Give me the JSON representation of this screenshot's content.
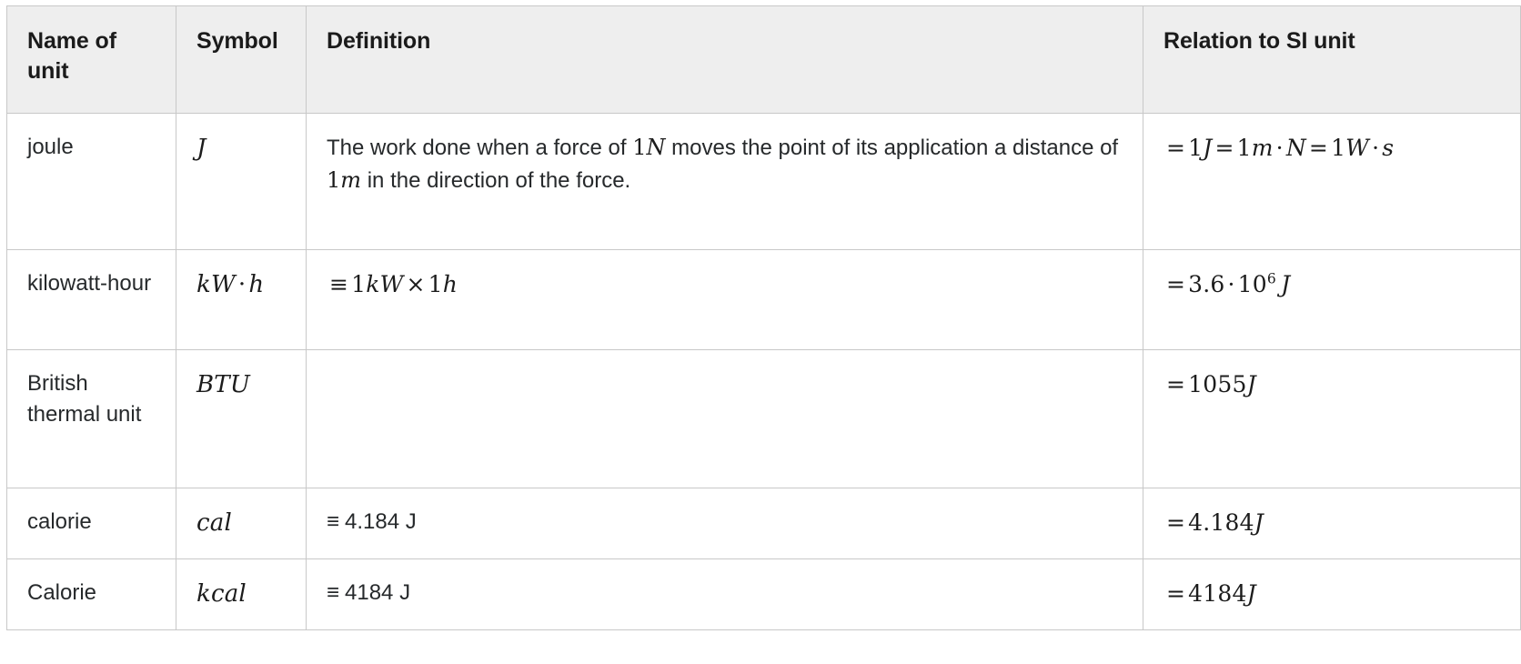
{
  "table": {
    "headers": [
      {
        "key": "name",
        "label": "Name of unit"
      },
      {
        "key": "symbol",
        "label": "Symbol"
      },
      {
        "key": "definition",
        "label": "Definition"
      },
      {
        "key": "relation",
        "label": "Relation to SI unit"
      }
    ],
    "rows": [
      {
        "name": "joule",
        "symbol": "J",
        "definition_parts": {
          "t1": "The work done when a force of ",
          "m1_num": "1",
          "m1_unit": "N",
          "t2": " moves the point of its application a distance of ",
          "m2_num": "1",
          "m2_unit": "m",
          "t3": " in the direction of the force."
        },
        "relation": {
          "eq1": "=",
          "n1": "1",
          "u1": "J",
          "eq2": "=",
          "n2": "1",
          "u2": "m",
          "dot1": "·",
          "u3": "N",
          "eq3": "=",
          "n3": "1",
          "u4": "W",
          "dot2": "·",
          "u5": "s"
        }
      },
      {
        "name": "kilowatt-hour",
        "symbol_parts": {
          "u1": "kW",
          "dot": "·",
          "u2": "h"
        },
        "definition": {
          "equiv": "≡",
          "n1": "1",
          "u1": "kW",
          "times": "×",
          "n2": "1",
          "u2": "h"
        },
        "relation": {
          "eq": "=",
          "mantissa": "3.6",
          "dot": "·",
          "base": "10",
          "exp": "6",
          "unit": "J"
        }
      },
      {
        "name": "British thermal unit",
        "symbol": "BTU",
        "definition": "",
        "relation": {
          "eq": "=",
          "value": "1055",
          "unit": "J"
        }
      },
      {
        "name": "calorie",
        "symbol": "cal",
        "definition_plain": {
          "equiv": "≡",
          "text": "4.184 J"
        },
        "relation": {
          "eq": "=",
          "value": "4.184",
          "unit": "J"
        }
      },
      {
        "name": "Calorie",
        "symbol": "kcal",
        "definition_plain": {
          "equiv": "≡",
          "text": "4184 J"
        },
        "relation": {
          "eq": "=",
          "value": "4184",
          "unit": "J"
        }
      }
    ]
  },
  "colors": {
    "header_background": "#eeeeee",
    "border": "#c8c8c8",
    "text": "#26292b",
    "header_text": "#1b1b1b",
    "cell_background": "#ffffff"
  }
}
